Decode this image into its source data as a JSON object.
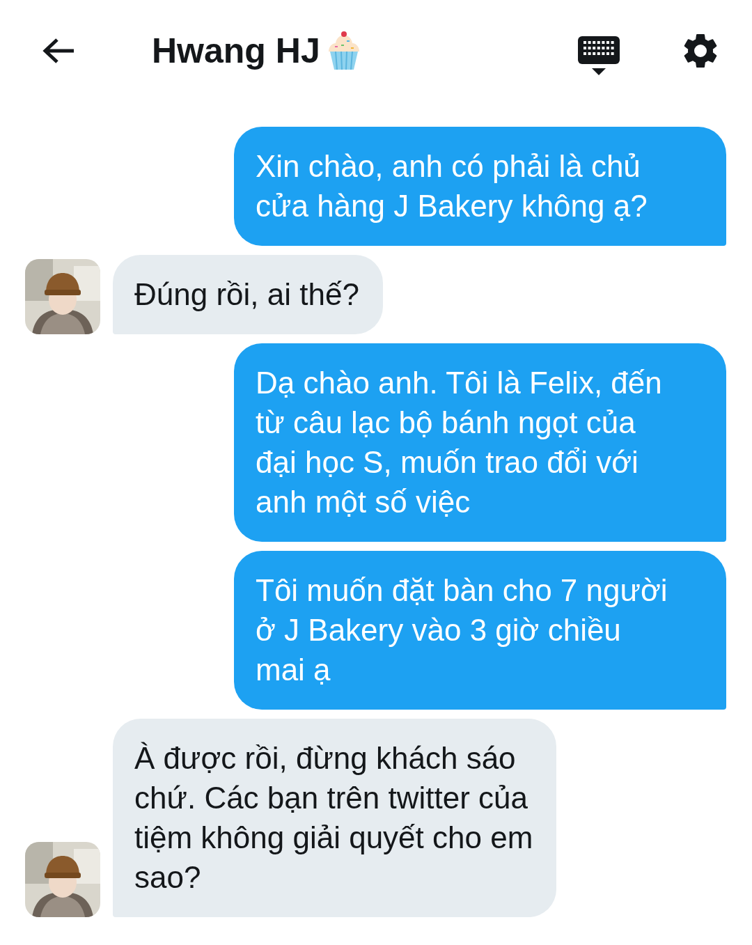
{
  "header": {
    "title": "Hwang HJ"
  },
  "messages": [
    {
      "kind": "sent",
      "text": "Xin chào, anh có phải là chủ\ncửa hàng J Bakery không ạ?"
    },
    {
      "kind": "received",
      "text": "Đúng rồi, ai thế?"
    },
    {
      "kind": "sent",
      "text": "Dạ chào anh. Tôi là Felix, đến\ntừ câu lạc bộ bánh ngọt của\nđại học S, muốn trao đổi với\nanh một số việc"
    },
    {
      "kind": "sent",
      "text": "Tôi muốn đặt bàn cho 7 người\nở J Bakery vào 3 giờ chiều\nmai ạ"
    },
    {
      "kind": "received",
      "text": "À được rồi, đừng khách sáo\nchứ. Các bạn trên twitter của\ntiệm không giải quyết cho em\nsao?"
    }
  ]
}
